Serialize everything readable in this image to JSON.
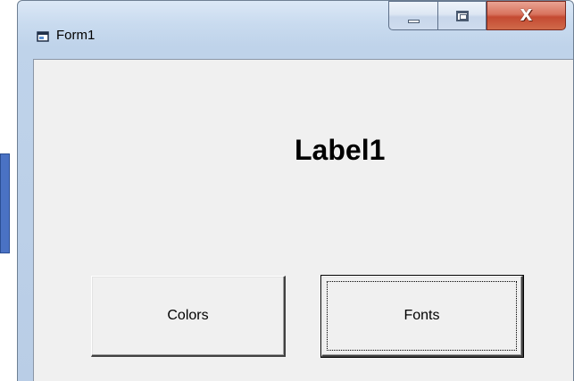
{
  "window": {
    "title": "Form1",
    "icon": "form-icon",
    "caption_buttons": {
      "minimize": "minimize-icon",
      "maximize": "maximize-icon",
      "close": "close-icon",
      "close_glyph": "X"
    }
  },
  "form": {
    "label1": "Label1",
    "buttons": {
      "colors": "Colors",
      "fonts": "Fonts"
    }
  },
  "colors": {
    "title_bar": "#c9dbef",
    "client_area": "#f0f0f0",
    "close_button": "#c44a32",
    "side_block": "#4a72c4"
  }
}
